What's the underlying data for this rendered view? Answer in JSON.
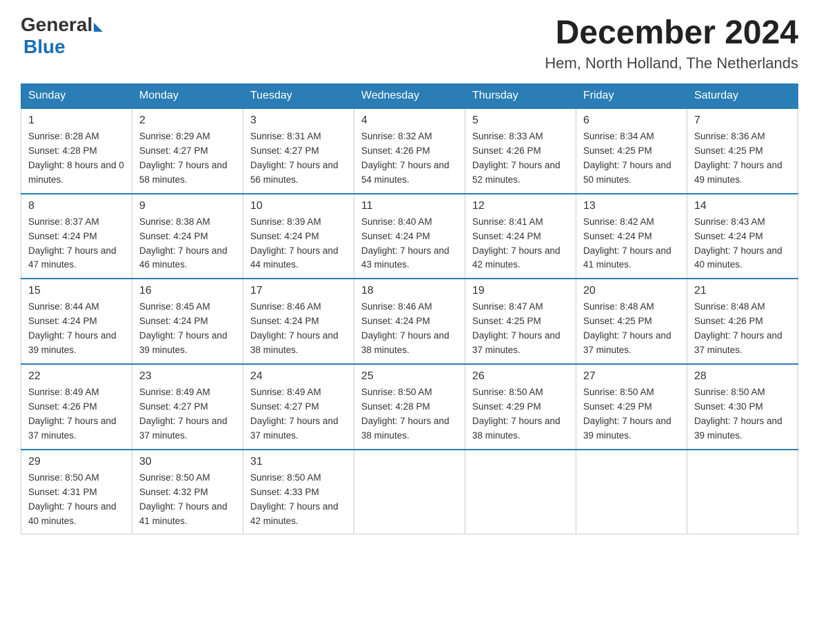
{
  "header": {
    "logo_general": "General",
    "logo_blue": "Blue",
    "month_title": "December 2024",
    "subtitle": "Hem, North Holland, The Netherlands"
  },
  "days_of_week": [
    "Sunday",
    "Monday",
    "Tuesday",
    "Wednesday",
    "Thursday",
    "Friday",
    "Saturday"
  ],
  "weeks": [
    [
      {
        "day": "1",
        "sunrise": "8:28 AM",
        "sunset": "4:28 PM",
        "daylight": "8 hours and 0 minutes."
      },
      {
        "day": "2",
        "sunrise": "8:29 AM",
        "sunset": "4:27 PM",
        "daylight": "7 hours and 58 minutes."
      },
      {
        "day": "3",
        "sunrise": "8:31 AM",
        "sunset": "4:27 PM",
        "daylight": "7 hours and 56 minutes."
      },
      {
        "day": "4",
        "sunrise": "8:32 AM",
        "sunset": "4:26 PM",
        "daylight": "7 hours and 54 minutes."
      },
      {
        "day": "5",
        "sunrise": "8:33 AM",
        "sunset": "4:26 PM",
        "daylight": "7 hours and 52 minutes."
      },
      {
        "day": "6",
        "sunrise": "8:34 AM",
        "sunset": "4:25 PM",
        "daylight": "7 hours and 50 minutes."
      },
      {
        "day": "7",
        "sunrise": "8:36 AM",
        "sunset": "4:25 PM",
        "daylight": "7 hours and 49 minutes."
      }
    ],
    [
      {
        "day": "8",
        "sunrise": "8:37 AM",
        "sunset": "4:24 PM",
        "daylight": "7 hours and 47 minutes."
      },
      {
        "day": "9",
        "sunrise": "8:38 AM",
        "sunset": "4:24 PM",
        "daylight": "7 hours and 46 minutes."
      },
      {
        "day": "10",
        "sunrise": "8:39 AM",
        "sunset": "4:24 PM",
        "daylight": "7 hours and 44 minutes."
      },
      {
        "day": "11",
        "sunrise": "8:40 AM",
        "sunset": "4:24 PM",
        "daylight": "7 hours and 43 minutes."
      },
      {
        "day": "12",
        "sunrise": "8:41 AM",
        "sunset": "4:24 PM",
        "daylight": "7 hours and 42 minutes."
      },
      {
        "day": "13",
        "sunrise": "8:42 AM",
        "sunset": "4:24 PM",
        "daylight": "7 hours and 41 minutes."
      },
      {
        "day": "14",
        "sunrise": "8:43 AM",
        "sunset": "4:24 PM",
        "daylight": "7 hours and 40 minutes."
      }
    ],
    [
      {
        "day": "15",
        "sunrise": "8:44 AM",
        "sunset": "4:24 PM",
        "daylight": "7 hours and 39 minutes."
      },
      {
        "day": "16",
        "sunrise": "8:45 AM",
        "sunset": "4:24 PM",
        "daylight": "7 hours and 39 minutes."
      },
      {
        "day": "17",
        "sunrise": "8:46 AM",
        "sunset": "4:24 PM",
        "daylight": "7 hours and 38 minutes."
      },
      {
        "day": "18",
        "sunrise": "8:46 AM",
        "sunset": "4:24 PM",
        "daylight": "7 hours and 38 minutes."
      },
      {
        "day": "19",
        "sunrise": "8:47 AM",
        "sunset": "4:25 PM",
        "daylight": "7 hours and 37 minutes."
      },
      {
        "day": "20",
        "sunrise": "8:48 AM",
        "sunset": "4:25 PM",
        "daylight": "7 hours and 37 minutes."
      },
      {
        "day": "21",
        "sunrise": "8:48 AM",
        "sunset": "4:26 PM",
        "daylight": "7 hours and 37 minutes."
      }
    ],
    [
      {
        "day": "22",
        "sunrise": "8:49 AM",
        "sunset": "4:26 PM",
        "daylight": "7 hours and 37 minutes."
      },
      {
        "day": "23",
        "sunrise": "8:49 AM",
        "sunset": "4:27 PM",
        "daylight": "7 hours and 37 minutes."
      },
      {
        "day": "24",
        "sunrise": "8:49 AM",
        "sunset": "4:27 PM",
        "daylight": "7 hours and 37 minutes."
      },
      {
        "day": "25",
        "sunrise": "8:50 AM",
        "sunset": "4:28 PM",
        "daylight": "7 hours and 38 minutes."
      },
      {
        "day": "26",
        "sunrise": "8:50 AM",
        "sunset": "4:29 PM",
        "daylight": "7 hours and 38 minutes."
      },
      {
        "day": "27",
        "sunrise": "8:50 AM",
        "sunset": "4:29 PM",
        "daylight": "7 hours and 39 minutes."
      },
      {
        "day": "28",
        "sunrise": "8:50 AM",
        "sunset": "4:30 PM",
        "daylight": "7 hours and 39 minutes."
      }
    ],
    [
      {
        "day": "29",
        "sunrise": "8:50 AM",
        "sunset": "4:31 PM",
        "daylight": "7 hours and 40 minutes."
      },
      {
        "day": "30",
        "sunrise": "8:50 AM",
        "sunset": "4:32 PM",
        "daylight": "7 hours and 41 minutes."
      },
      {
        "day": "31",
        "sunrise": "8:50 AM",
        "sunset": "4:33 PM",
        "daylight": "7 hours and 42 minutes."
      },
      null,
      null,
      null,
      null
    ]
  ]
}
